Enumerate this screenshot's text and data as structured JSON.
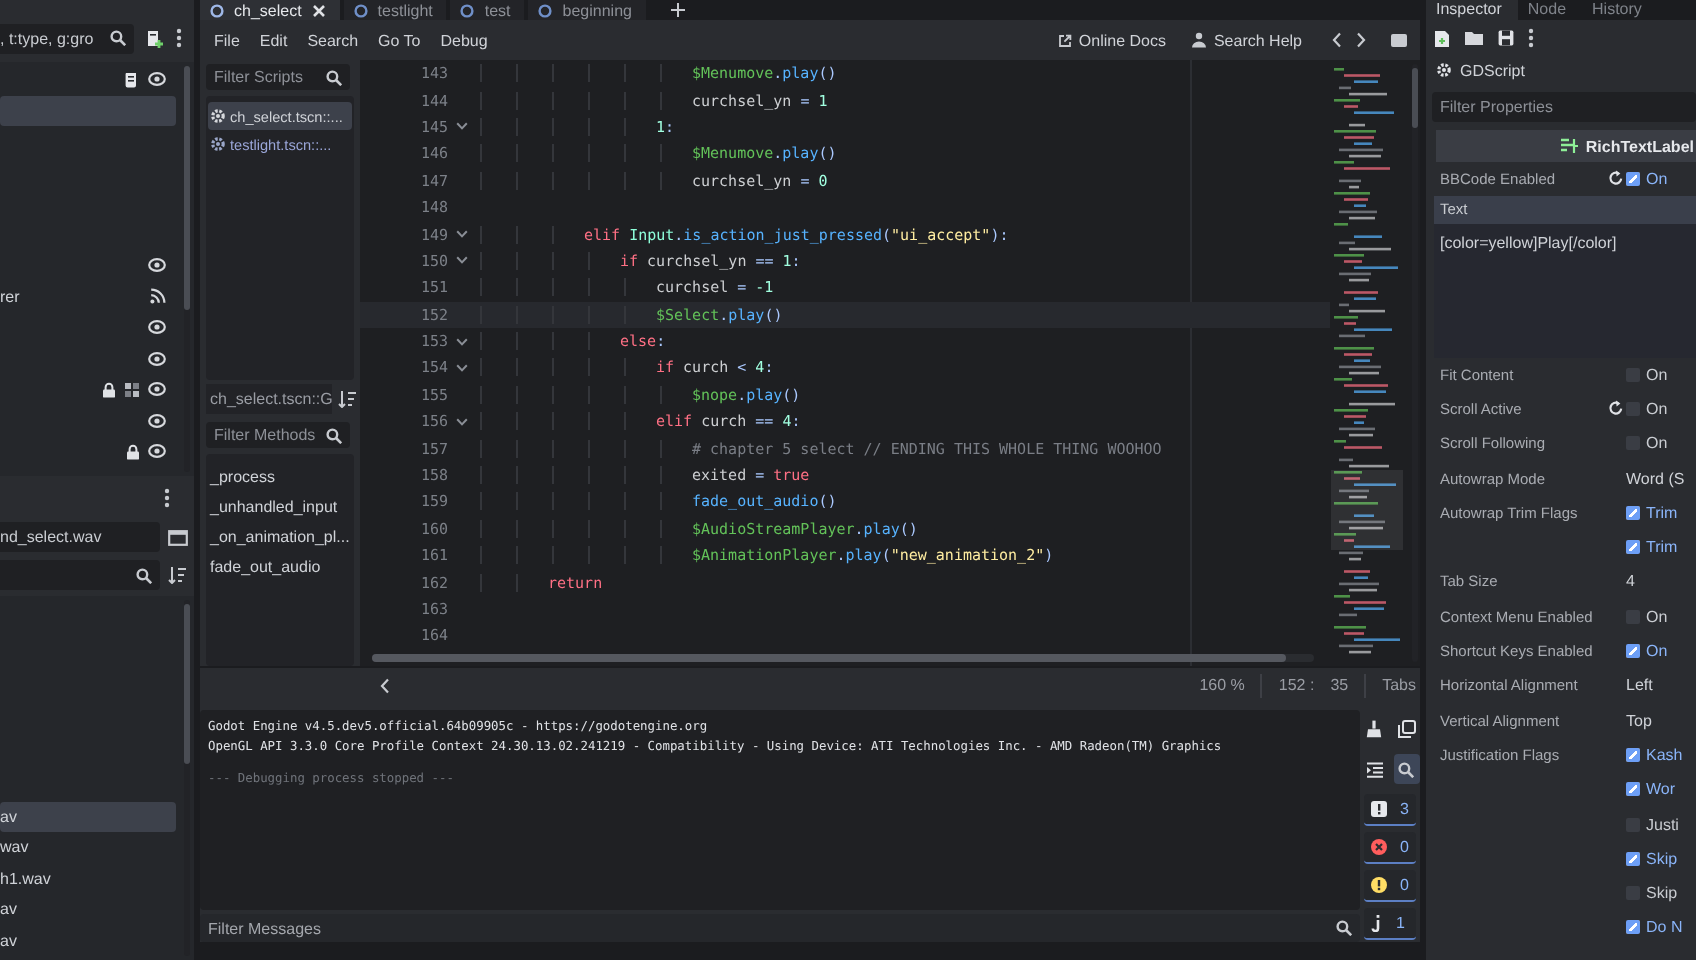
{
  "left_dock": {
    "scene_filter": ", t:type, g:gro",
    "scene_tree": [
      {
        "kind": "scripted",
        "selected": false
      },
      {
        "kind": "blank",
        "selected": true
      },
      {
        "kind": "blank",
        "selected": false
      },
      {
        "kind": "blank",
        "selected": false
      },
      {
        "kind": "blank",
        "selected": false
      },
      {
        "kind": "blank",
        "selected": false
      },
      {
        "kind": "visible",
        "selected": false
      },
      {
        "kind": "audio",
        "label": "rer",
        "selected": false
      },
      {
        "kind": "visible",
        "selected": false
      },
      {
        "kind": "visible",
        "selected": false
      },
      {
        "kind": "locked_grouped",
        "selected": false
      },
      {
        "kind": "visible",
        "selected": false
      },
      {
        "kind": "locked",
        "selected": false
      }
    ],
    "fs_path": "nd_select.wav",
    "files": [
      {
        "name": "av",
        "selected": true
      },
      {
        "name": "wav",
        "selected": false
      },
      {
        "name": "h1.wav",
        "selected": false
      },
      {
        "name": "av",
        "selected": false
      },
      {
        "name": "av",
        "selected": false
      }
    ]
  },
  "editor_tabs": [
    {
      "label": "ch_select",
      "selected": true,
      "closable": true
    },
    {
      "label": "testlight",
      "selected": false,
      "closable": false
    },
    {
      "label": "test",
      "selected": false,
      "closable": false
    },
    {
      "label": "beginning",
      "selected": false,
      "closable": false
    }
  ],
  "menu": [
    "File",
    "Edit",
    "Search",
    "Go To",
    "Debug"
  ],
  "help_links": [
    "Online Docs",
    "Search Help"
  ],
  "scripts": {
    "filter_placeholder": "Filter Scripts",
    "items": [
      {
        "label": "ch_select.tscn::...",
        "selected": true
      },
      {
        "label": "testlight.tscn::...",
        "selected": false
      }
    ],
    "current": "ch_select.tscn::G",
    "methods_placeholder": "Filter Methods",
    "methods": [
      "_process",
      "_unhandled_input",
      "_on_animation_pl...",
      "fade_out_audio"
    ]
  },
  "code": {
    "lines": [
      {
        "number": "143",
        "fold": false,
        "current": false,
        "tokens": [
          {
            "text": "\t\t\t\t\t\t$Menumove",
            "kind": "node"
          },
          {
            "text": ".",
            "kind": "sym"
          },
          {
            "text": "play",
            "kind": "call"
          },
          {
            "text": "()",
            "kind": "sym"
          }
        ]
      },
      {
        "number": "144",
        "fold": false,
        "current": false,
        "tokens": [
          {
            "text": "\t\t\t\t\t\tcurchsel_yn ",
            "kind": "plain"
          },
          {
            "text": "= ",
            "kind": "sym"
          },
          {
            "text": "1",
            "kind": "num"
          }
        ]
      },
      {
        "number": "145",
        "fold": true,
        "current": false,
        "tokens": [
          {
            "text": "\t\t\t\t\t1",
            "kind": "num"
          },
          {
            "text": ":",
            "kind": "sym"
          }
        ]
      },
      {
        "number": "146",
        "fold": false,
        "current": false,
        "tokens": [
          {
            "text": "\t\t\t\t\t\t$Menumove",
            "kind": "node"
          },
          {
            "text": ".",
            "kind": "sym"
          },
          {
            "text": "play",
            "kind": "call"
          },
          {
            "text": "()",
            "kind": "sym"
          }
        ]
      },
      {
        "number": "147",
        "fold": false,
        "current": false,
        "tokens": [
          {
            "text": "\t\t\t\t\t\tcurchsel_yn ",
            "kind": "plain"
          },
          {
            "text": "= ",
            "kind": "sym"
          },
          {
            "text": "0",
            "kind": "num"
          }
        ]
      },
      {
        "number": "148",
        "fold": false,
        "current": false
      },
      {
        "number": "149",
        "fold": true,
        "current": false,
        "tokens": [
          {
            "text": "\t\t\telif ",
            "kind": "kw"
          },
          {
            "text": "Input",
            "kind": "class"
          },
          {
            "text": ".",
            "kind": "sym"
          },
          {
            "text": "is_action_just_pressed",
            "kind": "call"
          },
          {
            "text": "(",
            "kind": "sym"
          },
          {
            "text": "\"ui_accept\"",
            "kind": "str"
          },
          {
            "text": "):",
            "kind": "sym"
          }
        ]
      },
      {
        "number": "150",
        "fold": true,
        "current": false,
        "tokens": [
          {
            "text": "\t\t\t\tif",
            "kind": "kw"
          },
          {
            "text": " curchsel_yn ",
            "kind": "plain"
          },
          {
            "text": "== ",
            "kind": "sym"
          },
          {
            "text": "1",
            "kind": "num"
          },
          {
            "text": ":",
            "kind": "sym"
          }
        ]
      },
      {
        "number": "151",
        "fold": false,
        "current": false,
        "tokens": [
          {
            "text": "\t\t\t\t\tcurchsel ",
            "kind": "plain"
          },
          {
            "text": "= ",
            "kind": "sym"
          },
          {
            "text": "-1",
            "kind": "num"
          }
        ]
      },
      {
        "number": "152",
        "fold": false,
        "current": true,
        "tokens": [
          {
            "text": "\t\t\t\t\t$Select",
            "kind": "node"
          },
          {
            "text": ".",
            "kind": "sym"
          },
          {
            "text": "play",
            "kind": "call"
          },
          {
            "text": "()",
            "kind": "sym"
          }
        ]
      },
      {
        "number": "153",
        "fold": true,
        "current": false,
        "tokens": [
          {
            "text": "\t\t\t\telse",
            "kind": "kw"
          },
          {
            "text": ":",
            "kind": "sym"
          }
        ]
      },
      {
        "number": "154",
        "fold": true,
        "current": false,
        "tokens": [
          {
            "text": "\t\t\t\t\tif",
            "kind": "kw"
          },
          {
            "text": " curch ",
            "kind": "plain"
          },
          {
            "text": "< ",
            "kind": "sym"
          },
          {
            "text": "4",
            "kind": "num"
          },
          {
            "text": ":",
            "kind": "sym"
          }
        ]
      },
      {
        "number": "155",
        "fold": false,
        "current": false,
        "tokens": [
          {
            "text": "\t\t\t\t\t\t$nope",
            "kind": "node"
          },
          {
            "text": ".",
            "kind": "sym"
          },
          {
            "text": "play",
            "kind": "call"
          },
          {
            "text": "()",
            "kind": "sym"
          }
        ]
      },
      {
        "number": "156",
        "fold": true,
        "current": false,
        "tokens": [
          {
            "text": "\t\t\t\t\telif",
            "kind": "kw"
          },
          {
            "text": " curch ",
            "kind": "plain"
          },
          {
            "text": "== ",
            "kind": "sym"
          },
          {
            "text": "4",
            "kind": "num"
          },
          {
            "text": ":",
            "kind": "sym"
          }
        ]
      },
      {
        "number": "157",
        "fold": false,
        "current": false,
        "tokens": [
          {
            "text": "\t\t\t\t\t\t# chapter 5 select // ENDING THIS WHOLE THING WOOHOO",
            "kind": "comment"
          }
        ]
      },
      {
        "number": "158",
        "fold": false,
        "current": false,
        "tokens": [
          {
            "text": "\t\t\t\t\t\texited ",
            "kind": "plain"
          },
          {
            "text": "= ",
            "kind": "sym"
          },
          {
            "text": "true",
            "kind": "kw"
          }
        ]
      },
      {
        "number": "159",
        "fold": false,
        "current": false,
        "tokens": [
          {
            "text": "\t\t\t\t\t\tfade_out_audio",
            "kind": "call"
          },
          {
            "text": "()",
            "kind": "sym"
          }
        ]
      },
      {
        "number": "160",
        "fold": false,
        "current": false,
        "tokens": [
          {
            "text": "\t\t\t\t\t\t$AudioStreamPlayer",
            "kind": "node"
          },
          {
            "text": ".",
            "kind": "sym"
          },
          {
            "text": "play",
            "kind": "call"
          },
          {
            "text": "()",
            "kind": "sym"
          }
        ]
      },
      {
        "number": "161",
        "fold": false,
        "current": false,
        "tokens": [
          {
            "text": "\t\t\t\t\t\t$AnimationPlayer",
            "kind": "node"
          },
          {
            "text": ".",
            "kind": "sym"
          },
          {
            "text": "play",
            "kind": "call"
          },
          {
            "text": "(",
            "kind": "sym"
          },
          {
            "text": "\"new_animation_2\"",
            "kind": "str"
          },
          {
            "text": ")",
            "kind": "sym"
          }
        ]
      },
      {
        "number": "162",
        "fold": false,
        "current": false,
        "tokens": [
          {
            "text": "\t\treturn",
            "kind": "kw"
          }
        ]
      },
      {
        "number": "163",
        "fold": false,
        "current": false
      },
      {
        "number": "164",
        "fold": false,
        "current": false
      }
    ]
  },
  "status_bar": {
    "zoom": "160 %",
    "line": "152 :",
    "column": "35",
    "indent_mode": "Tabs"
  },
  "output": {
    "lines": [
      {
        "text": "Godot Engine v4.5.dev5.official.64b09905c - https://godotengine.org",
        "kind": "info"
      },
      {
        "text": "OpenGL API 3.3.0 Core Profile Context 24.30.13.02.241219 - Compatibility - Using Device: ATI Technologies Inc. - AMD Radeon(TM) Graphics",
        "kind": "info"
      },
      {
        "text": "--- Debugging process stopped ---",
        "kind": "muted"
      }
    ],
    "filter_placeholder": "Filter Messages",
    "counters": [
      {
        "kind": "message",
        "count": "3",
        "on": true
      },
      {
        "kind": "error",
        "count": "0",
        "on": true
      },
      {
        "kind": "warning",
        "count": "0",
        "on": true
      },
      {
        "kind": "editor",
        "count": "1",
        "on": true
      }
    ]
  },
  "inspector": {
    "tabs": [
      {
        "label": "Inspector",
        "selected": true
      },
      {
        "label": "Node",
        "selected": false
      },
      {
        "label": "History",
        "selected": false
      }
    ],
    "script_type": "GDScript",
    "filter_placeholder": "Filter Properties",
    "class_name": "RichTextLabel",
    "properties": [
      {
        "kind": "check",
        "label": "BBCode Enabled",
        "revert": true,
        "checked": true,
        "value": "On"
      },
      {
        "kind": "text",
        "label": "Text",
        "revert": false,
        "value": "[color=yellow]Play[/color]"
      },
      {
        "kind": "check",
        "label": "Fit Content",
        "revert": false,
        "checked": false,
        "value": "On"
      },
      {
        "kind": "check",
        "label": "Scroll Active",
        "revert": true,
        "checked": false,
        "value": "On"
      },
      {
        "kind": "check",
        "label": "Scroll Following",
        "revert": false,
        "checked": false,
        "value": "On"
      },
      {
        "kind": "value",
        "label": "Autowrap Mode",
        "revert": false,
        "value": "Word (S"
      },
      {
        "kind": "check",
        "label": "Autowrap Trim Flags",
        "revert": false,
        "checked": true,
        "value": "Trim"
      },
      {
        "kind": "check",
        "revert": false,
        "checked": true,
        "value": "Trim"
      },
      {
        "kind": "value",
        "label": "Tab Size",
        "revert": false,
        "value": "4"
      },
      {
        "kind": "check",
        "label": "Context Menu Enabled",
        "revert": false,
        "checked": false,
        "value": "On"
      },
      {
        "kind": "check",
        "label": "Shortcut Keys Enabled",
        "revert": false,
        "checked": true,
        "value": "On"
      },
      {
        "kind": "value",
        "label": "Horizontal Alignment",
        "revert": false,
        "value": "Left"
      },
      {
        "kind": "value",
        "label": "Vertical Alignment",
        "revert": false,
        "value": "Top"
      },
      {
        "kind": "check",
        "label": "Justification Flags",
        "revert": false,
        "checked": true,
        "value": "Kash"
      },
      {
        "kind": "check",
        "revert": false,
        "checked": true,
        "value": "Wor"
      },
      {
        "kind": "check",
        "revert": false,
        "checked": false,
        "value": "Justi"
      },
      {
        "kind": "check",
        "revert": false,
        "checked": true,
        "value": "Skip"
      },
      {
        "kind": "check",
        "revert": false,
        "checked": false,
        "value": "Skip"
      },
      {
        "kind": "check",
        "revert": false,
        "checked": true,
        "value": "Do N"
      }
    ]
  }
}
